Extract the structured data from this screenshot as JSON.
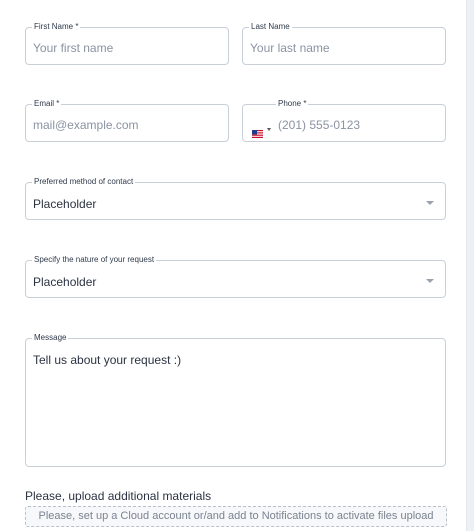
{
  "form": {
    "first_name": {
      "label": "First Name *",
      "placeholder": "Your first name"
    },
    "last_name": {
      "label": "Last Name",
      "placeholder": "Your last name"
    },
    "email": {
      "label": "Email  *",
      "placeholder": "mail@example.com"
    },
    "phone": {
      "label": "Phone *",
      "placeholder": "(201) 555-0123",
      "country_icon": "us-flag-icon"
    },
    "contact_method": {
      "label": "Preferred method of contact",
      "value": "Placeholder"
    },
    "request_nature": {
      "label": "Specify the nature of your request",
      "value": "Placeholder"
    },
    "message": {
      "label": "Message",
      "placeholder": "Tell us about your request :)"
    },
    "upload": {
      "title": "Please, upload additional materials",
      "notice": "Please, set up a Cloud account or/and add to Notifications to activate files upload"
    }
  },
  "colors": {
    "border": "#c9cfd8",
    "text": "#2b3342",
    "placeholder": "#8a93a2"
  }
}
